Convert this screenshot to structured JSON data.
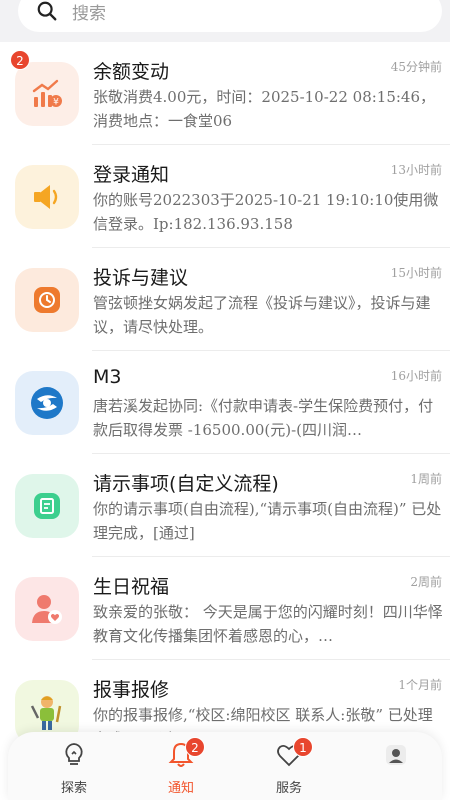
{
  "search": {
    "placeholder": "搜索"
  },
  "messages": [
    {
      "title": "余额变动",
      "time": "45分钟前",
      "desc": "张敬消费4.00元，时间：2025-10-22 08:15:46，消费地点：一食堂06",
      "badge": "2",
      "icon": "balance-chart-icon",
      "tile_color": "#fdeee7",
      "icon_color": "#f07a4a"
    },
    {
      "title": "登录通知",
      "time": "13小时前",
      "desc": "你的账号2022303于2025-10-21 19:10:10使用微信登录。Ip:182.136.93.158",
      "icon": "speaker-icon",
      "tile_color": "#fdf2dc",
      "icon_color": "#f5a623"
    },
    {
      "title": "投诉与建议",
      "time": "15小时前",
      "desc": "管弦顿挫女娲发起了流程《投诉与建议》，投诉与建议，请尽快处理。",
      "icon": "clock-icon",
      "tile_color": "#fdeadd",
      "icon_color": "#ee7a2e"
    },
    {
      "title": "M3",
      "time": "16小时前",
      "desc": "唐若溪发起协同:《付款申请表-学生保险费预付，付款后取得发票 -16500.00(元)-(四川润…",
      "icon": "m3-logo-icon",
      "tile_color": "#e3eefa",
      "icon_color": "#1e78c8"
    },
    {
      "title": "请示事项(自定义流程)",
      "time": "1周前",
      "desc": "你的请示事项(自由流程),“请示事项(自由流程)” 已处理完成，[通过]",
      "icon": "document-edit-icon",
      "tile_color": "#dff6ea",
      "icon_color": "#3ccf8e"
    },
    {
      "title": "生日祝福",
      "time": "2周前",
      "desc": "致亲爱的张敬： 今天是属于您的闪耀时刻！四川华怿教育文化传播集团怀着感恩的心，…",
      "icon": "user-heart-icon",
      "tile_color": "#fde6e6",
      "icon_color": "#ef7a6e"
    },
    {
      "title": "报事报修",
      "time": "1个月前",
      "desc": "你的报事报修,“校区:绵阳校区 联系人:张敬” 已处理完成，[通过]",
      "icon": "repair-worker-icon",
      "tile_color": "#f1f8e0",
      "icon_color": "#8bbf3a"
    }
  ],
  "tabs": [
    {
      "label": "探索",
      "icon": "lightbulb-icon",
      "badge": ""
    },
    {
      "label": "通知",
      "icon": "bell-icon",
      "badge": "2",
      "active": true
    },
    {
      "label": "服务",
      "icon": "heart-icon",
      "badge": "1"
    },
    {
      "label": "",
      "icon": "avatar-icon",
      "badge": ""
    }
  ],
  "colors": {
    "accent": "#f2552c",
    "badge": "#e8462e"
  }
}
